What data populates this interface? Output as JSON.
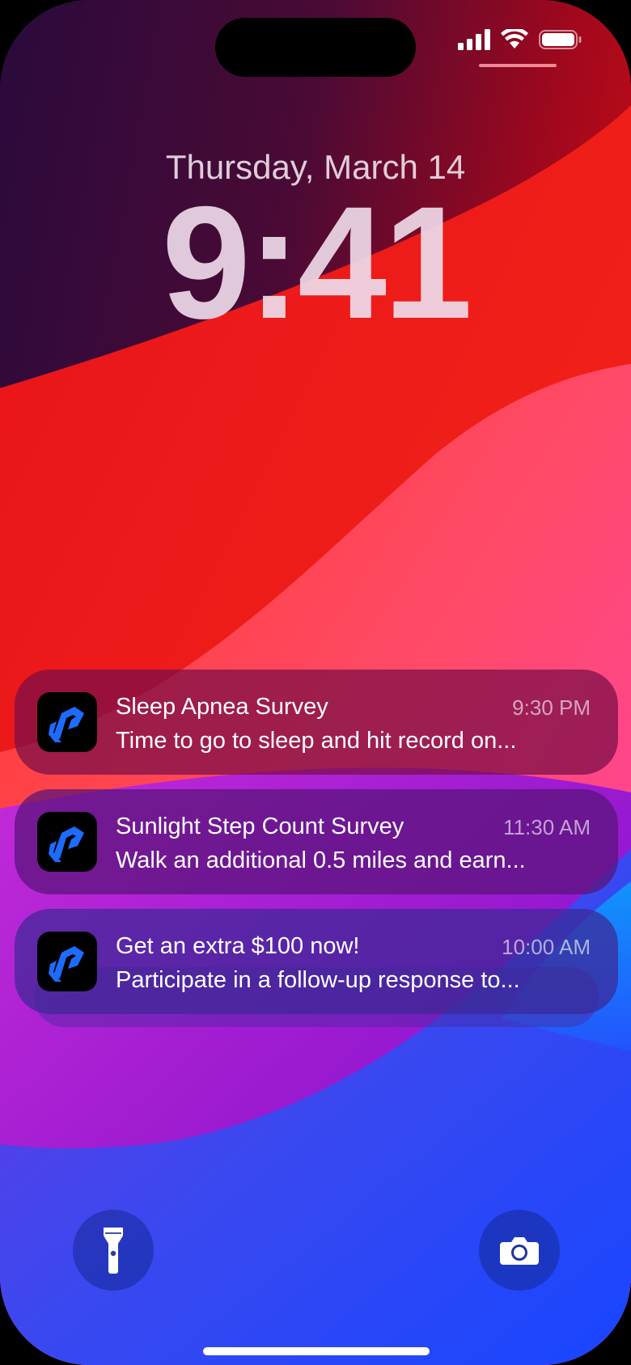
{
  "colors": {
    "accent_blue": "#1e6bff",
    "wallpaper_red": "#e8141b",
    "wallpaper_blue": "#1846ff"
  },
  "lockscreen": {
    "date": "Thursday, March 14",
    "time": "9:41"
  },
  "status_bar": {
    "icons": [
      "cellular-signal-icon",
      "wifi-icon",
      "battery-icon"
    ]
  },
  "notifications": [
    {
      "app_icon": "survey-app-icon",
      "title": "Sleep Apnea Survey",
      "body": "Time to go to sleep and hit record on...",
      "time": "9:30 PM"
    },
    {
      "app_icon": "survey-app-icon",
      "title": "Sunlight Step Count Survey",
      "body": "Walk an additional 0.5 miles and earn...",
      "time": "11:30 AM"
    },
    {
      "app_icon": "survey-app-icon",
      "title": "Get an extra $100 now!",
      "body": "Participate in a follow-up response to...",
      "time": "10:00 AM"
    }
  ],
  "quick_actions": {
    "left": "flashlight-icon",
    "right": "camera-icon"
  }
}
